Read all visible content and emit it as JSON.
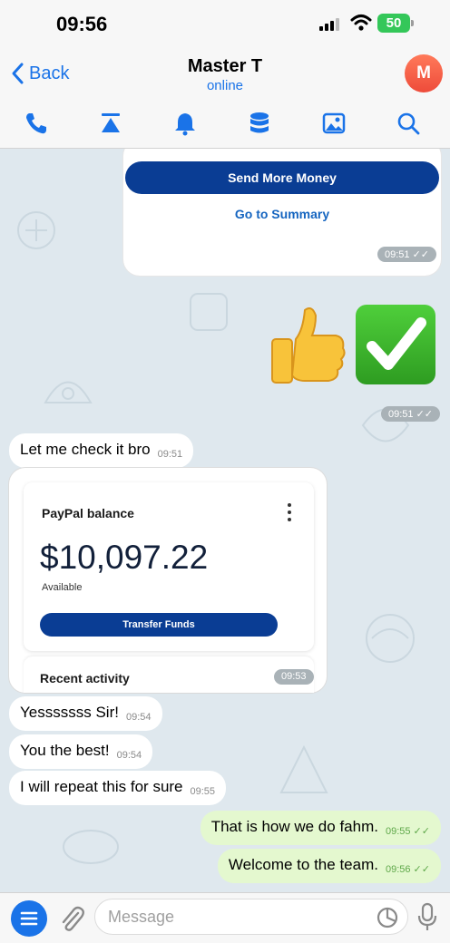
{
  "status": {
    "time": "09:56",
    "battery": "50"
  },
  "header": {
    "back_label": "Back",
    "contact_name": "Master T",
    "contact_status": "online",
    "avatar_initial": "M",
    "toolbar_icons": [
      "phone-icon",
      "pin-icon",
      "bell-icon",
      "database-icon",
      "image-icon",
      "search-icon"
    ]
  },
  "messages": {
    "top_card": {
      "send_more": "Send More Money",
      "go_summary": "Go to Summary",
      "time": "09:51"
    },
    "emoji": {
      "time": "09:51"
    },
    "m1": {
      "text": "Let me check it bro",
      "time": "09:51"
    },
    "paypal": {
      "title": "PayPal balance",
      "amount": "$10,097.22",
      "available": "Available",
      "transfer": "Transfer Funds",
      "recent": "Recent activity",
      "time": "09:53"
    },
    "m2": {
      "text": "Yesssssss Sir!",
      "time": "09:54"
    },
    "m3": {
      "text": "You the best!",
      "time": "09:54"
    },
    "m4": {
      "text": "I will repeat this for sure",
      "time": "09:55"
    },
    "m5": {
      "text": "That is how we do fahm.",
      "time": "09:55"
    },
    "m6": {
      "text": "Welcome to the team.",
      "time": "09:56"
    }
  },
  "composer": {
    "placeholder": "Message"
  },
  "colors": {
    "accent": "#1a73e8",
    "outgoing_bubble": "#e4f8cf",
    "paypal_blue": "#0a3d94"
  }
}
